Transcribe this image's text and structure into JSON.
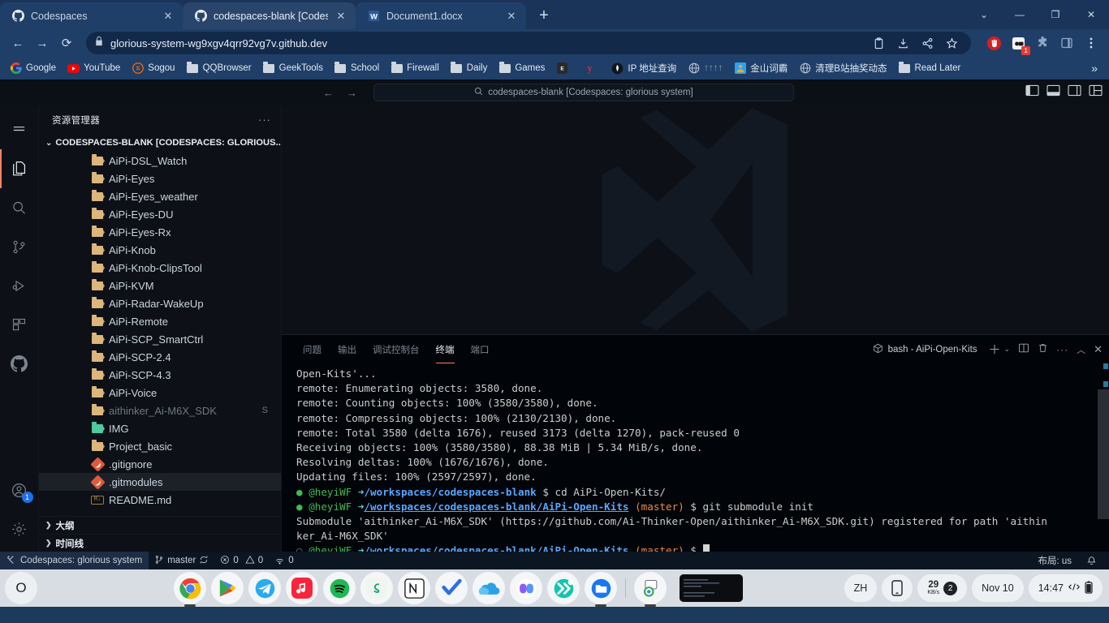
{
  "browser": {
    "tabs": [
      {
        "title": "Codespaces",
        "favicon": "github-icon",
        "active": false
      },
      {
        "title": "codespaces-blank [Codespaces",
        "favicon": "github-icon",
        "active": true
      },
      {
        "title": "Document1.docx",
        "favicon": "word-icon",
        "active": false
      }
    ],
    "new_tab_label": "+",
    "window_controls": {
      "expand": "⌄",
      "minimize": "—",
      "restore": "❐",
      "close": "✕"
    },
    "nav": {
      "back": "←",
      "forward": "→",
      "reload": "⟳"
    },
    "omnibox": {
      "lock_icon": "lock-icon",
      "url": "glorious-system-wg9xgv4qrr92vg7v.github.dev",
      "actions": [
        "clipboard-icon",
        "install-icon",
        "share-icon",
        "bookmark-star-icon"
      ]
    },
    "extensions": [
      "stop-hand-icon",
      "adblock-icon",
      "puzzle-extensions-icon",
      "side-panel-icon",
      "chrome-menu-icon"
    ],
    "extension_badge": "1",
    "bookmarks": [
      {
        "label": "Google",
        "icon": "google-icon"
      },
      {
        "label": "YouTube",
        "icon": "youtube-icon"
      },
      {
        "label": "Sogou",
        "icon": "sogou-icon"
      },
      {
        "label": "QQBrowser",
        "icon": "folder-icon"
      },
      {
        "label": "GeekTools",
        "icon": "folder-icon"
      },
      {
        "label": "School",
        "icon": "folder-icon"
      },
      {
        "label": "Firewall",
        "icon": "folder-icon"
      },
      {
        "label": "Daily",
        "icon": "folder-icon"
      },
      {
        "label": "Games",
        "icon": "folder-icon"
      },
      {
        "label": "",
        "icon": "epic-games-icon"
      },
      {
        "label": "",
        "icon": "yandex-icon"
      },
      {
        "label": "IP 地址查询",
        "icon": "ip-lookup-icon"
      },
      {
        "label": "↑↑↑↑",
        "icon": "globe-icon"
      },
      {
        "label": "金山词霸",
        "icon": "kingsoft-icon"
      },
      {
        "label": "清理B站抽奖动态",
        "icon": "globe-icon"
      },
      {
        "label": "Read Later",
        "icon": "folder-icon"
      }
    ],
    "bookmarks_overflow": "»"
  },
  "vscode": {
    "titlebar": {
      "back": "←",
      "forward": "→",
      "command_center": {
        "search_icon": "search-icon",
        "text": "codespaces-blank [Codespaces: glorious system]"
      },
      "layout_icons": [
        "toggle-primary-sidebar-icon",
        "toggle-panel-icon",
        "toggle-secondary-sidebar-icon",
        "customize-layout-icon"
      ]
    },
    "activitybar": {
      "items": [
        {
          "name": "menu-icon",
          "active": false,
          "badge": null
        },
        {
          "name": "explorer-icon",
          "active": true,
          "badge": null
        },
        {
          "name": "search-icon",
          "active": false,
          "badge": null
        },
        {
          "name": "source-control-icon",
          "active": false,
          "badge": null
        },
        {
          "name": "run-debug-icon",
          "active": false,
          "badge": null
        },
        {
          "name": "extensions-icon",
          "active": false,
          "badge": null
        },
        {
          "name": "github-icon",
          "active": false,
          "badge": null
        }
      ],
      "bottom": [
        {
          "name": "accounts-icon",
          "badge": "1"
        },
        {
          "name": "settings-gear-icon",
          "badge": null
        }
      ]
    },
    "sidebar": {
      "title": "资源管理器",
      "more_actions": "···",
      "root": {
        "label": "CODESPACES-BLANK [CODESPACES: GLORIOUS...",
        "expanded": true
      },
      "files": [
        {
          "name": "AiPi-DSL_Watch",
          "type": "folder",
          "suffix": ""
        },
        {
          "name": "AiPi-Eyes",
          "type": "folder",
          "suffix": ""
        },
        {
          "name": "AiPi-Eyes_weather",
          "type": "folder",
          "suffix": ""
        },
        {
          "name": "AiPi-Eyes-DU",
          "type": "folder",
          "suffix": ""
        },
        {
          "name": "AiPi-Eyes-Rx",
          "type": "folder",
          "suffix": ""
        },
        {
          "name": "AiPi-Knob",
          "type": "folder",
          "suffix": ""
        },
        {
          "name": "AiPi-Knob-ClipsTool",
          "type": "folder",
          "suffix": ""
        },
        {
          "name": "AiPi-KVM",
          "type": "folder",
          "suffix": ""
        },
        {
          "name": "AiPi-Radar-WakeUp",
          "type": "folder",
          "suffix": ""
        },
        {
          "name": "AiPi-Remote",
          "type": "folder",
          "suffix": ""
        },
        {
          "name": "AiPi-SCP_SmartCtrl",
          "type": "folder",
          "suffix": ""
        },
        {
          "name": "AiPi-SCP-2.4",
          "type": "folder",
          "suffix": ""
        },
        {
          "name": "AiPi-SCP-4.3",
          "type": "folder",
          "suffix": ""
        },
        {
          "name": "AiPi-Voice",
          "type": "folder",
          "suffix": ""
        },
        {
          "name": "aithinker_Ai-M6X_SDK",
          "type": "folder-dim",
          "suffix": "S"
        },
        {
          "name": "IMG",
          "type": "folder-img",
          "suffix": ""
        },
        {
          "name": "Project_basic",
          "type": "folder",
          "suffix": ""
        },
        {
          "name": ".gitignore",
          "type": "git",
          "suffix": ""
        },
        {
          "name": ".gitmodules",
          "type": "git",
          "suffix": "",
          "selected": true
        },
        {
          "name": "README.md",
          "type": "md",
          "suffix": ""
        }
      ],
      "sections": [
        {
          "label": "大纲"
        },
        {
          "label": "时间线"
        }
      ]
    },
    "panel": {
      "tabs": [
        {
          "label": "问题",
          "active": false
        },
        {
          "label": "输出",
          "active": false
        },
        {
          "label": "调试控制台",
          "active": false
        },
        {
          "label": "终端",
          "active": true
        },
        {
          "label": "端口",
          "active": false
        }
      ],
      "terminal_name": "bash - AiPi-Open-Kits",
      "actions": [
        "new-terminal-icon",
        "terminal-dropdown-icon",
        "split-terminal-icon",
        "kill-terminal-icon",
        "more-actions-icon",
        "maximize-panel-icon",
        "close-panel-icon"
      ],
      "terminal_lines": [
        {
          "kind": "plain",
          "text": "Open-Kits'..."
        },
        {
          "kind": "plain",
          "text": "remote: Enumerating objects: 3580, done."
        },
        {
          "kind": "plain",
          "text": "remote: Counting objects: 100% (3580/3580), done."
        },
        {
          "kind": "plain",
          "text": "remote: Compressing objects: 100% (2130/2130), done."
        },
        {
          "kind": "plain",
          "text": "remote: Total 3580 (delta 1676), reused 3173 (delta 1270), pack-reused 0"
        },
        {
          "kind": "plain",
          "text": "Receiving objects: 100% (3580/3580), 88.38 MiB | 5.34 MiB/s, done."
        },
        {
          "kind": "plain",
          "text": "Resolving deltas: 100% (1676/1676), done."
        },
        {
          "kind": "plain",
          "text": "Updating files: 100% (2597/2597), done."
        },
        {
          "kind": "prompt",
          "marker": "filled",
          "user": "@heyiWF",
          "arrow": "➜",
          "path": "/workspaces/codespaces-blank",
          "branch": "",
          "dollar": "$",
          "command": " cd AiPi-Open-Kits/"
        },
        {
          "kind": "prompt",
          "marker": "filled",
          "user": "@heyiWF",
          "arrow": "➜",
          "path": "/workspaces/codespaces-blank/AiPi-Open-Kits",
          "branch": "(master)",
          "dollar": "$",
          "command": " git submodule init"
        },
        {
          "kind": "plain",
          "text": "Submodule 'aithinker_Ai-M6X_SDK' (https://github.com/Ai-Thinker-Open/aithinker_Ai-M6X_SDK.git) registered for path 'aithin"
        },
        {
          "kind": "plain",
          "text": "ker_Ai-M6X_SDK'"
        },
        {
          "kind": "prompt",
          "marker": "hollow",
          "user": "@heyiWF",
          "arrow": "➜",
          "path": "/workspaces/codespaces-blank/AiPi-Open-Kits",
          "branch": "(master)",
          "dollar": "$",
          "command": "",
          "cursor": true
        }
      ]
    },
    "statusbar": {
      "remote": {
        "icon": "remote-indicator-icon",
        "label": "Codespaces: glorious system"
      },
      "branch": {
        "icon": "source-control-branch-icon",
        "label": "master",
        "sync_icon": "sync-icon"
      },
      "problems": {
        "errors_icon": "error-icon",
        "errors": "0",
        "warnings_icon": "warning-icon",
        "warnings": "0"
      },
      "ports": {
        "icon": "ports-icon",
        "count": "0"
      },
      "layout": "布局: us",
      "bell": "notifications-bell-icon"
    }
  },
  "taskbar": {
    "start": {
      "name": "start-button",
      "glyph": "O"
    },
    "apps": [
      {
        "name": "chrome-icon",
        "running": true
      },
      {
        "name": "google-play-icon",
        "running": false
      },
      {
        "name": "telegram-icon",
        "running": false
      },
      {
        "name": "apple-music-icon",
        "running": false
      },
      {
        "name": "spotify-icon",
        "running": false
      },
      {
        "name": "sigma-icon",
        "running": false
      },
      {
        "name": "notion-icon",
        "running": false
      },
      {
        "name": "todoist-check-icon",
        "running": false
      },
      {
        "name": "onedrive-icon",
        "running": false
      },
      {
        "name": "copilot-icon",
        "running": false
      },
      {
        "name": "fast-forward-icon",
        "running": false
      },
      {
        "name": "file-explorer-icon",
        "running": true
      }
    ],
    "pinned_after_divider": {
      "name": "chrome-window-preview-icon",
      "running": true
    },
    "preview_thumb": {
      "name": "terminal-window-thumbnail"
    },
    "tray": {
      "ime": "ZH",
      "phone_link": "phone-link-icon",
      "network_speed": {
        "value": "29",
        "unit": "KB/s"
      },
      "hidden_count": "2",
      "date": "Nov 10",
      "time": "14:47",
      "network_icon": "network-icon",
      "battery_icon": "battery-icon"
    }
  }
}
